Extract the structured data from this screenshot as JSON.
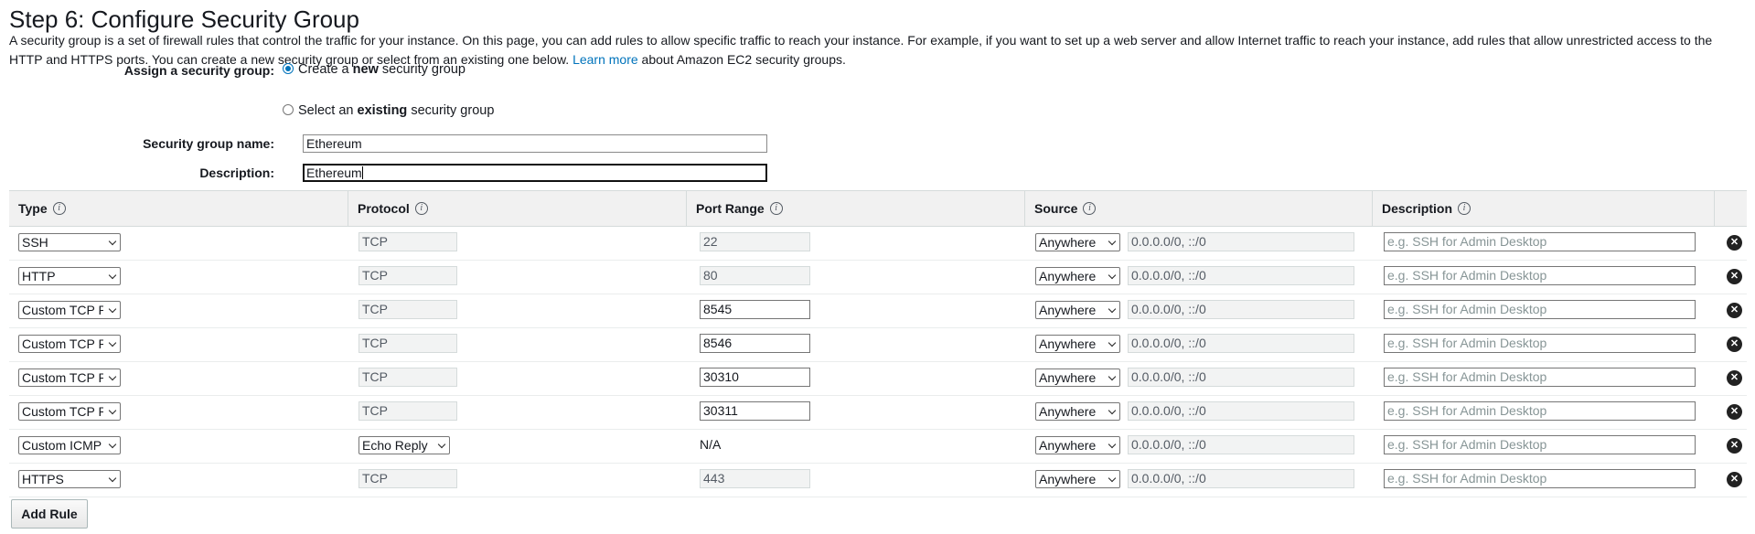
{
  "page": {
    "title": "Step 6: Configure Security Group",
    "intro_text": "A security group is a set of firewall rules that control the traffic for your instance. On this page, you can add rules to allow specific traffic to reach your instance. For example, if you want to set up a web server and allow Internet traffic to reach your instance, add rules that allow unrestricted access to the HTTP and HTTPS ports. You can create a new security group or select from an existing one below.",
    "learn_more": "Learn more",
    "learn_more_suffix": "about Amazon EC2 security groups."
  },
  "form": {
    "assign_label": "Assign a security group:",
    "option_create_pre": "Create a ",
    "option_create_bold": "new",
    "option_create_post": " security group",
    "option_select_pre": "Select an ",
    "option_select_bold": "existing",
    "option_select_post": " security group",
    "selected_option": "create",
    "name_label": "Security group name:",
    "name_value": "Ethereum",
    "description_label": "Description:",
    "description_value": "Ethereum"
  },
  "table": {
    "headers": {
      "type": "Type",
      "protocol": "Protocol",
      "port_range": "Port Range",
      "source": "Source",
      "description": "Description"
    },
    "description_placeholder": "e.g. SSH for Admin Desktop",
    "rows": [
      {
        "type": "SSH",
        "protocol": "TCP",
        "protocol_kind": "readonly",
        "port": "22",
        "port_kind": "readonly",
        "source": "Anywhere",
        "cidr": "0.0.0.0/0, ::/0"
      },
      {
        "type": "HTTP",
        "protocol": "TCP",
        "protocol_kind": "readonly",
        "port": "80",
        "port_kind": "readonly",
        "source": "Anywhere",
        "cidr": "0.0.0.0/0, ::/0"
      },
      {
        "type": "Custom TCP R",
        "protocol": "TCP",
        "protocol_kind": "readonly",
        "port": "8545",
        "port_kind": "editable",
        "source": "Anywhere",
        "cidr": "0.0.0.0/0, ::/0"
      },
      {
        "type": "Custom TCP R",
        "protocol": "TCP",
        "protocol_kind": "readonly",
        "port": "8546",
        "port_kind": "editable",
        "source": "Anywhere",
        "cidr": "0.0.0.0/0, ::/0"
      },
      {
        "type": "Custom TCP R",
        "protocol": "TCP",
        "protocol_kind": "readonly",
        "port": "30310",
        "port_kind": "editable",
        "source": "Anywhere",
        "cidr": "0.0.0.0/0, ::/0"
      },
      {
        "type": "Custom TCP R",
        "protocol": "TCP",
        "protocol_kind": "readonly",
        "port": "30311",
        "port_kind": "editable",
        "source": "Anywhere",
        "cidr": "0.0.0.0/0, ::/0"
      },
      {
        "type": "Custom ICMP",
        "protocol": "Echo Reply",
        "protocol_kind": "select",
        "port": "N/A",
        "port_kind": "plain",
        "source": "Anywhere",
        "cidr": "0.0.0.0/0, ::/0"
      },
      {
        "type": "HTTPS",
        "protocol": "TCP",
        "protocol_kind": "readonly",
        "port": "443",
        "port_kind": "readonly",
        "source": "Anywhere",
        "cidr": "0.0.0.0/0, ::/0"
      }
    ],
    "delete_icon": "close-circle-icon"
  },
  "add_rule_label": "Add Rule",
  "colors": {
    "link": "#0073bb",
    "header_bg": "#f1f1f1",
    "readonly_bg": "#f2f3f3"
  }
}
